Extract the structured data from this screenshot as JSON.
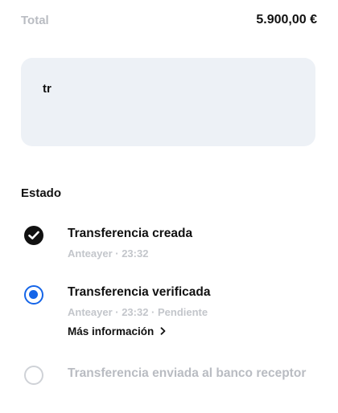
{
  "summary": {
    "total_label": "Total",
    "total_value": "5.900,00 €"
  },
  "note": {
    "text": "tr"
  },
  "status": {
    "title": "Estado",
    "steps": [
      {
        "title": "Transferencia creada",
        "meta": "Anteayer · 23:32",
        "state": "done",
        "icon": "checkmark-icon"
      },
      {
        "title": "Transferencia verificada",
        "meta": "Anteayer · 23:32 · Pendiente",
        "state": "current",
        "icon": "radio-selected-icon",
        "link_label": "Más información"
      },
      {
        "title": "Transferencia enviada al banco receptor",
        "state": "pending",
        "icon": "radio-empty-icon"
      }
    ]
  },
  "colors": {
    "accent": "#1565e8",
    "muted_text": "#b9bcc2",
    "note_background": "#edf1f6"
  }
}
